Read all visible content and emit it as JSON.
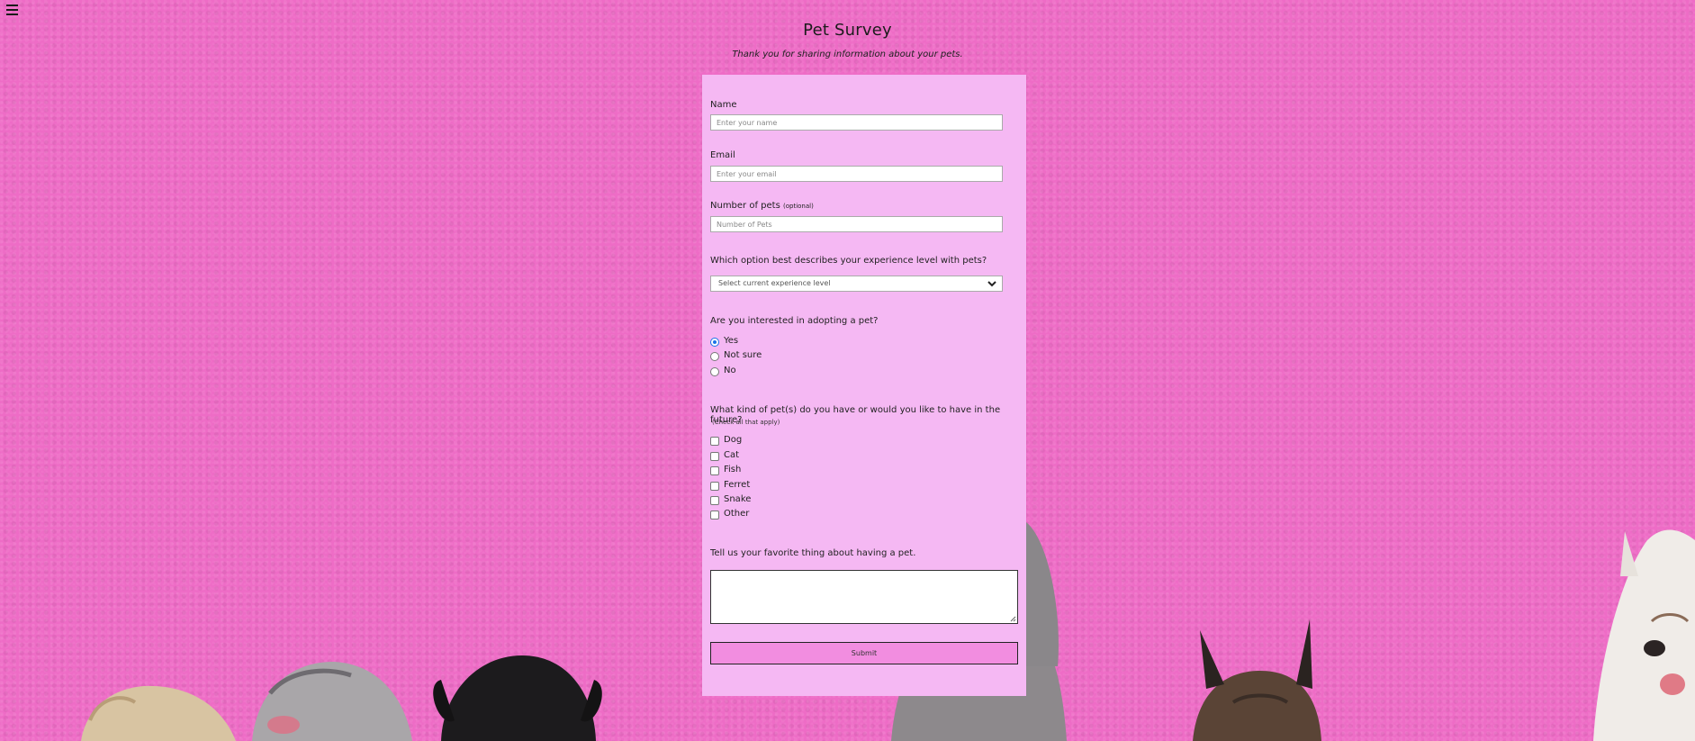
{
  "menu": {
    "icon": "hamburger-menu-icon"
  },
  "header": {
    "title": "Pet Survey",
    "subtitle": "Thank you for sharing information about your pets."
  },
  "form": {
    "name": {
      "label": "Name",
      "placeholder": "Enter your name"
    },
    "email": {
      "label": "Email",
      "placeholder": "Enter your email"
    },
    "pets_count": {
      "label": "Number of pets",
      "optional_note": "(optional)",
      "placeholder": "Number of Pets"
    },
    "experience": {
      "question": "Which option best describes your experience level with pets?",
      "selected": "Select current experience level",
      "icon": "chevron-down-icon"
    },
    "adopt": {
      "question": "Are you interested in adopting a pet?",
      "options": [
        "Yes",
        "Not sure",
        "No"
      ],
      "selected": "Yes"
    },
    "pet_kinds": {
      "question": "What kind of pet(s) do you have or would you like to have in the future?",
      "note": "(Check all that apply)",
      "options": [
        "Dog",
        "Cat",
        "Fish",
        "Ferret",
        "Snake",
        "Other"
      ]
    },
    "favorite": {
      "question": "Tell us your favorite thing about having a pet."
    },
    "submit_label": "Submit"
  },
  "colors": {
    "background": "#ee6cc6",
    "panel": "#f5b8f3",
    "submit": "#f28de0",
    "radio_accent": "#1a73e8"
  }
}
